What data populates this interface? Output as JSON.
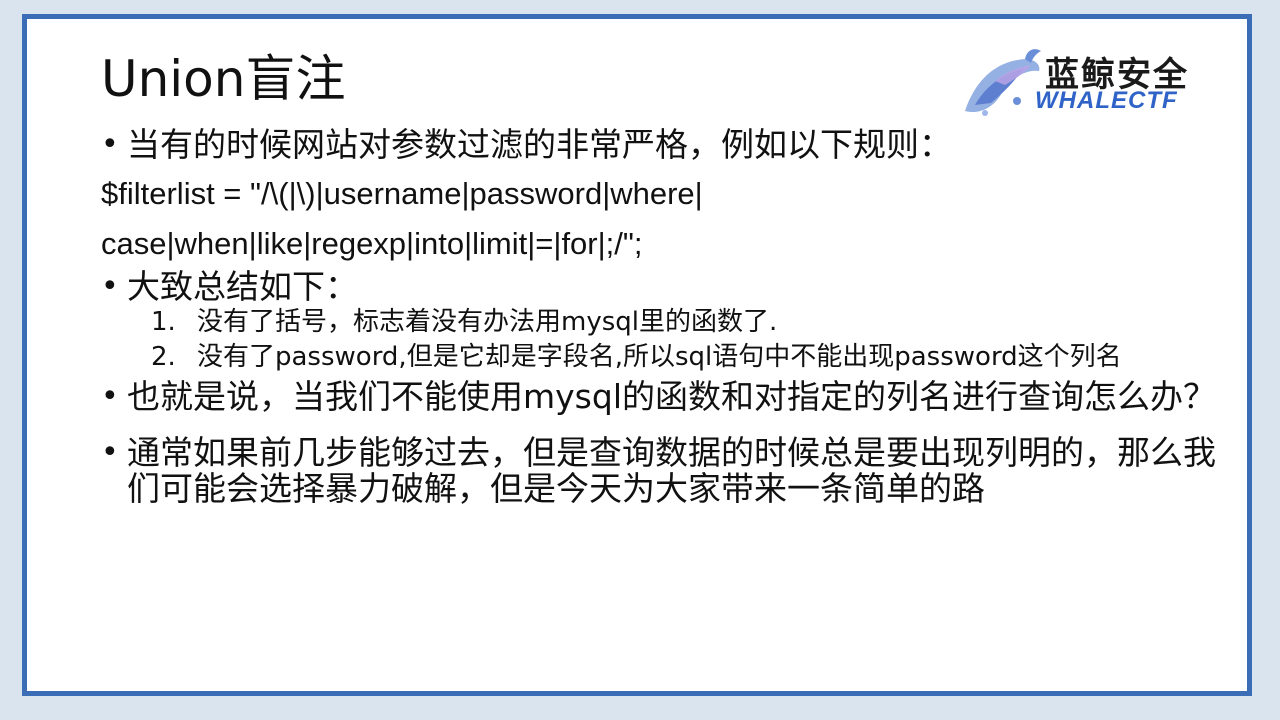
{
  "title": "Union盲注",
  "logo": {
    "cn": "蓝鲸安全",
    "en": "WHALECTF"
  },
  "bullets": [
    "当有的时候网站对参数过滤的非常严格，例如以下规则：",
    "大致总结如下：",
    "也就是说，当我们不能使用mysql的函数和对指定的列名进行查询怎么办？",
    "通常如果前几步能够过去，但是查询数据的时候总是要出现列明的，那么我们可能会选择暴力破解，但是今天为大家带来一条简单的路"
  ],
  "filter": {
    "line1": "$filterlist = \"/\\(|\\)|username|password|where|",
    "line2": "case|when|like|regexp|into|limit|=|for|;/\";"
  },
  "sublist": [
    {
      "num": "1.",
      "text": "没有了括号，标志着没有办法用mysql里的函数了."
    },
    {
      "num": "2.",
      "text": "没有了password,但是它却是字段名,所以sql语句中不能出现password这个列名"
    }
  ],
  "colors": {
    "border": "#3a6db5",
    "logo_en": "#2f63c7"
  }
}
